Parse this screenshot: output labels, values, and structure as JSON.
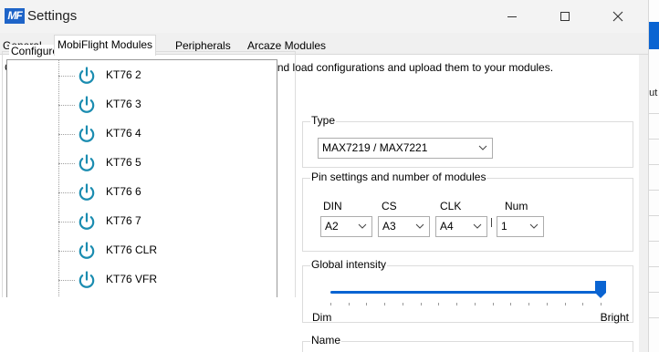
{
  "window": {
    "logo_text": "MF",
    "title": "Settings"
  },
  "tabs": [
    {
      "label": "General",
      "active": false
    },
    {
      "label": "MobiFlight Modules",
      "active": true
    },
    {
      "label": "Peripherals",
      "active": false
    },
    {
      "label": "Arcaze Modules",
      "active": false
    }
  ],
  "description": "Configure connected MobiFlight Boards. You can save and load configurations and upload them to your modules.",
  "modules_group": {
    "title": "Configured modules",
    "items": [
      {
        "label": "KT76 2",
        "icon": "power-icon"
      },
      {
        "label": "KT76 3",
        "icon": "power-icon"
      },
      {
        "label": "KT76 4",
        "icon": "power-icon"
      },
      {
        "label": "KT76 5",
        "icon": "power-icon"
      },
      {
        "label": "KT76 6",
        "icon": "power-icon"
      },
      {
        "label": "KT76 7",
        "icon": "power-icon"
      },
      {
        "label": "KT76 CLR",
        "icon": "power-icon"
      },
      {
        "label": "KT76 VFR",
        "icon": "power-icon"
      }
    ]
  },
  "type_group": {
    "title": "Type",
    "selected": "MAX7219 / MAX7221"
  },
  "pins_group": {
    "title": "Pin settings and number of modules",
    "din": {
      "label": "DIN",
      "value": "A2"
    },
    "cs": {
      "label": "CS",
      "value": "A3"
    },
    "clk": {
      "label": "CLK",
      "value": "A4"
    },
    "num": {
      "label": "Num",
      "value": "1"
    }
  },
  "intensity_group": {
    "title": "Global intensity",
    "min_label": "Dim",
    "max_label": "Bright",
    "level": 1.0
  },
  "name_group": {
    "title": "Name"
  },
  "background_window": {
    "text_fragment": "out"
  },
  "colors": {
    "accent": "#0a64d2",
    "power_icon": "#1a8cb0",
    "logo": "#1e64c8"
  }
}
